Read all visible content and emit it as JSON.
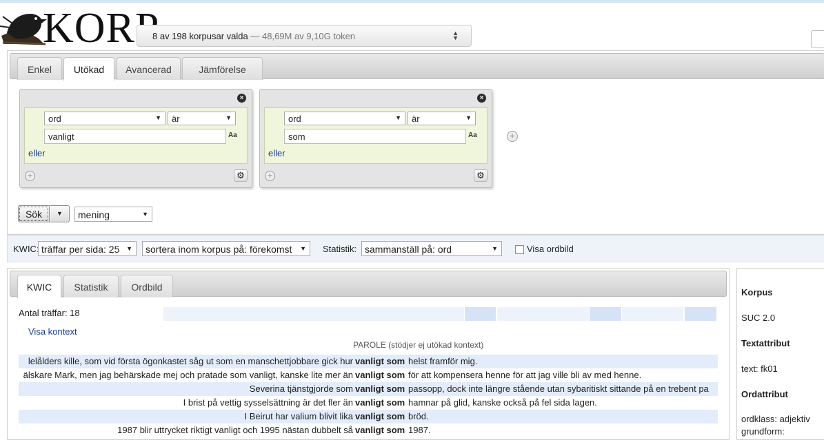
{
  "header": {
    "logo_text": "KORP",
    "corpus_chooser": {
      "count_text": "8 av 198 korpusar valda",
      "tokens_text": "— 48,69M av 9,10G token"
    }
  },
  "search_tabs": [
    {
      "label": "Enkel",
      "active": false
    },
    {
      "label": "Utökad",
      "active": true
    },
    {
      "label": "Avancerad",
      "active": false
    },
    {
      "label": "Jämförelse",
      "active": false
    }
  ],
  "tokens": [
    {
      "attribute": "ord",
      "operator": "är",
      "value": "vanligt",
      "case_label": "Aa",
      "or_label": "eller"
    },
    {
      "attribute": "ord",
      "operator": "är",
      "value": "som",
      "case_label": "Aa",
      "or_label": "eller"
    }
  ],
  "search": {
    "button_label": "Sök",
    "within": "mening"
  },
  "options": {
    "kwic_label": "KWIC:",
    "hits_per_page": "träffar per sida: 25",
    "sort": "sortera inom korpus på: förekomst",
    "stats_label": "Statistik:",
    "stats_select": "sammanställ på: ord",
    "word_picture_label": "Visa ordbild"
  },
  "result_tabs": [
    {
      "label": "KWIC",
      "active": true
    },
    {
      "label": "Statistik",
      "active": false
    },
    {
      "label": "Ordbild",
      "active": false
    }
  ],
  "results": {
    "hits_label": "Antal träffar: 18",
    "context_link": "Visa kontext",
    "corpus_header": "PAROLE   (stödjer ej utökad kontext)",
    "rows": [
      {
        "left": "lelålders kille, som vid första ögonkastet såg ut som en manschettjobbare gick hur",
        "match": "vanligt som",
        "right": "helst framför mig."
      },
      {
        "left": "älskare Mark, men jag behärskade mej och pratade som vanligt, kanske lite mer än",
        "match": "vanligt som",
        "right": "för att kompensera henne för att jag ville bli av med henne."
      },
      {
        "left": "Severina tjänstgjorde som",
        "match": "vanligt som",
        "right": "passopp, dock inte längre stående utan sybaritiskt sittande på en trebent pa"
      },
      {
        "left": "I brist på vettig sysselsättning är det fler än",
        "match": "vanligt som",
        "right": "hamnar på glid, kanske också på fel sida lagen."
      },
      {
        "left": "I Beirut har valium blivit lika",
        "match": "vanligt som",
        "right": "bröd."
      },
      {
        "left": "1987 blir uttrycket riktigt vanligt och 1995 nästan dubbelt så",
        "match": "vanligt som",
        "right": "1987."
      }
    ]
  },
  "sidebar": {
    "corpus_heading": "Korpus",
    "corpus_value": "SUC 2.0",
    "text_attr_heading": "Textattribut",
    "text_attr_value": "text: fk01",
    "word_attr_heading": "Ordattribut",
    "word_attr_pos": "ordklass: adjektiv",
    "word_attr_lemma": "grundform:"
  },
  "colors": {
    "accent_link": "#1a3c94",
    "token_bg": "#f0f6dc",
    "row_highlight": "#e2ecfb",
    "options_bg": "#eef3fa"
  }
}
